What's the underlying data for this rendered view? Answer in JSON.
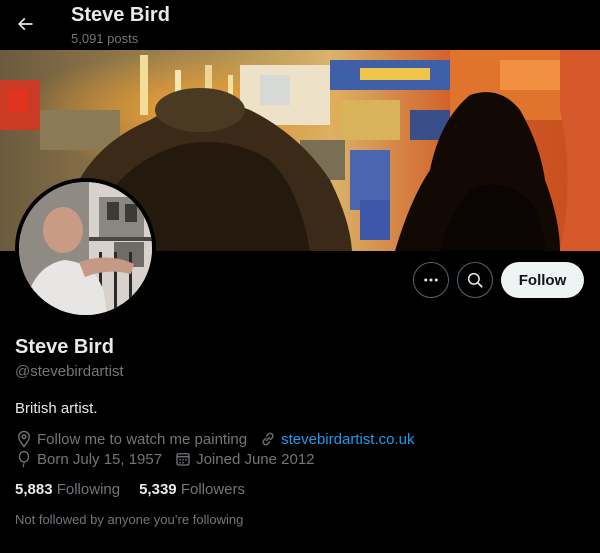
{
  "header": {
    "name": "Steve Bird",
    "posts_count": "5,091 posts",
    "back_icon": "arrow-left-icon"
  },
  "banner": {
    "description": "painting-banner",
    "colors": {
      "warm": "#c8491b",
      "dark": "#1a120a",
      "blue": "#3f5fa8"
    }
  },
  "actions": {
    "more_icon": "more-horizontal-icon",
    "search_icon": "search-icon",
    "follow_label": "Follow"
  },
  "profile": {
    "display_name": "Steve Bird",
    "handle": "@stevebirdartist",
    "bio": "British artist.",
    "location": "Follow me to watch me painting",
    "website": "stevebirdartist.co.uk",
    "birthday": "Born July 15, 1957",
    "joined": "Joined June 2012"
  },
  "stats": {
    "following_count": "5,883",
    "following_label": "Following",
    "followers_count": "5,339",
    "followers_label": "Followers"
  },
  "mutuals_text": "Not followed by anyone you’re following",
  "theme": {
    "background": "#000000",
    "text": "#e7e9ea",
    "muted": "#71767b",
    "link": "#1d9bf0",
    "button_bg": "#eff3f4"
  }
}
